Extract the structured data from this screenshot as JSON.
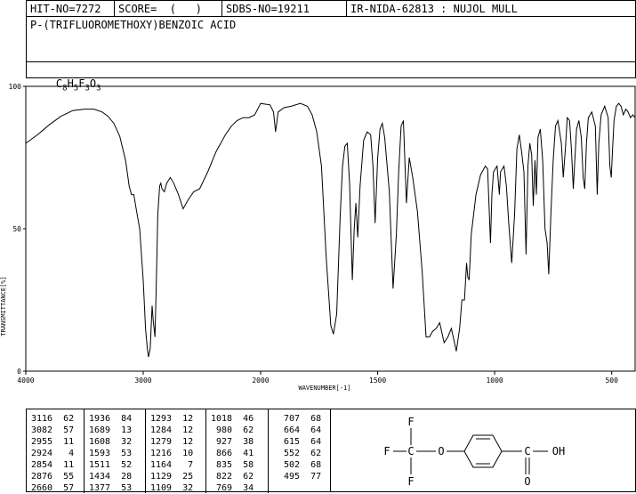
{
  "header": {
    "hit_no": "HIT-NO=7272",
    "score": "SCORE=  (   )",
    "sdbs_no": "SDBS-NO=19211",
    "ir_info": "IR-NIDA-62813 : NUJOL MULL",
    "compound_name": "P-(TRIFLUOROMETHOXY)BENZOIC ACID",
    "formula_main": "C",
    "formula": [
      {
        "el": "C",
        "n": "8"
      },
      {
        "el": "H",
        "n": "5"
      },
      {
        "el": "F",
        "n": "3"
      },
      {
        "el": "O",
        "n": "3"
      }
    ]
  },
  "chart_data": {
    "type": "line",
    "xlabel": "WAVENUMBER[-1]",
    "ylabel": "TRANSMITTANCE[%]",
    "xlim": [
      4000,
      400
    ],
    "ylim": [
      0,
      100
    ],
    "x_ticks": [
      "4000",
      "3000",
      "2000",
      "1500",
      "1000",
      "500"
    ],
    "x_tick_values": [
      4000,
      3000,
      2000,
      1500,
      1000,
      500
    ],
    "y_ticks": [
      "0",
      "50",
      "100"
    ],
    "y_tick_values": [
      0,
      50,
      100
    ],
    "line_color": "#000000",
    "series": [
      {
        "points": [
          [
            4000,
            80
          ],
          [
            3900,
            83
          ],
          [
            3800,
            86.5
          ],
          [
            3700,
            89.5
          ],
          [
            3600,
            91.5
          ],
          [
            3500,
            92
          ],
          [
            3420,
            92
          ],
          [
            3350,
            91
          ],
          [
            3300,
            89.5
          ],
          [
            3250,
            87
          ],
          [
            3200,
            82.5
          ],
          [
            3150,
            74
          ],
          [
            3120,
            65
          ],
          [
            3100,
            62
          ],
          [
            3080,
            62
          ],
          [
            3060,
            57
          ],
          [
            3030,
            50
          ],
          [
            3000,
            32
          ],
          [
            2980,
            15
          ],
          [
            2965,
            8
          ],
          [
            2955,
            5
          ],
          [
            2940,
            8
          ],
          [
            2924,
            23
          ],
          [
            2915,
            18
          ],
          [
            2900,
            12
          ],
          [
            2890,
            28
          ],
          [
            2876,
            55
          ],
          [
            2860,
            65
          ],
          [
            2850,
            66
          ],
          [
            2840,
            64
          ],
          [
            2820,
            63
          ],
          [
            2800,
            66
          ],
          [
            2770,
            68
          ],
          [
            2740,
            66
          ],
          [
            2700,
            62
          ],
          [
            2660,
            57
          ],
          [
            2620,
            60
          ],
          [
            2570,
            63
          ],
          [
            2520,
            64
          ],
          [
            2450,
            70
          ],
          [
            2380,
            77
          ],
          [
            2300,
            83
          ],
          [
            2250,
            86
          ],
          [
            2200,
            88
          ],
          [
            2150,
            89
          ],
          [
            2100,
            89
          ],
          [
            2050,
            90
          ],
          [
            2000,
            94
          ],
          [
            1960,
            93.5
          ],
          [
            1945,
            91
          ],
          [
            1936,
            84
          ],
          [
            1925,
            91
          ],
          [
            1900,
            92.5
          ],
          [
            1870,
            93
          ],
          [
            1830,
            94
          ],
          [
            1800,
            93
          ],
          [
            1780,
            90
          ],
          [
            1760,
            84
          ],
          [
            1740,
            72
          ],
          [
            1720,
            40
          ],
          [
            1700,
            16
          ],
          [
            1689,
            13
          ],
          [
            1675,
            20
          ],
          [
            1660,
            55
          ],
          [
            1650,
            72
          ],
          [
            1640,
            79
          ],
          [
            1630,
            80
          ],
          [
            1620,
            66
          ],
          [
            1608,
            32
          ],
          [
            1600,
            50
          ],
          [
            1593,
            59
          ],
          [
            1585,
            47
          ],
          [
            1575,
            65
          ],
          [
            1560,
            81
          ],
          [
            1545,
            84
          ],
          [
            1530,
            83
          ],
          [
            1520,
            72
          ],
          [
            1511,
            52
          ],
          [
            1500,
            75
          ],
          [
            1490,
            85
          ],
          [
            1480,
            87
          ],
          [
            1470,
            82
          ],
          [
            1450,
            63
          ],
          [
            1434,
            29
          ],
          [
            1420,
            48
          ],
          [
            1410,
            70
          ],
          [
            1400,
            86
          ],
          [
            1390,
            88
          ],
          [
            1377,
            59
          ],
          [
            1365,
            75
          ],
          [
            1350,
            68
          ],
          [
            1330,
            56
          ],
          [
            1310,
            35
          ],
          [
            1293,
            12
          ],
          [
            1284,
            12
          ],
          [
            1279,
            12
          ],
          [
            1265,
            14
          ],
          [
            1250,
            15
          ],
          [
            1235,
            17
          ],
          [
            1216,
            10
          ],
          [
            1200,
            12
          ],
          [
            1185,
            15
          ],
          [
            1164,
            7
          ],
          [
            1150,
            15
          ],
          [
            1140,
            25
          ],
          [
            1129,
            25
          ],
          [
            1120,
            38
          ],
          [
            1115,
            33
          ],
          [
            1109,
            32
          ],
          [
            1100,
            48
          ],
          [
            1080,
            62
          ],
          [
            1060,
            69
          ],
          [
            1040,
            72
          ],
          [
            1030,
            71
          ],
          [
            1018,
            45
          ],
          [
            1012,
            62
          ],
          [
            1005,
            70
          ],
          [
            990,
            72
          ],
          [
            980,
            62
          ],
          [
            975,
            70
          ],
          [
            960,
            72
          ],
          [
            950,
            65
          ],
          [
            940,
            52
          ],
          [
            927,
            38
          ],
          [
            915,
            55
          ],
          [
            905,
            78
          ],
          [
            895,
            83
          ],
          [
            885,
            77
          ],
          [
            875,
            70
          ],
          [
            866,
            41
          ],
          [
            858,
            72
          ],
          [
            850,
            80
          ],
          [
            842,
            76
          ],
          [
            835,
            58
          ],
          [
            828,
            74
          ],
          [
            822,
            62
          ],
          [
            815,
            82
          ],
          [
            805,
            85
          ],
          [
            795,
            74
          ],
          [
            785,
            50
          ],
          [
            776,
            45
          ],
          [
            769,
            34
          ],
          [
            760,
            55
          ],
          [
            750,
            74
          ],
          [
            740,
            86
          ],
          [
            730,
            88
          ],
          [
            715,
            80
          ],
          [
            707,
            68
          ],
          [
            698,
            78
          ],
          [
            690,
            89
          ],
          [
            680,
            88
          ],
          [
            672,
            78
          ],
          [
            664,
            64
          ],
          [
            655,
            78
          ],
          [
            650,
            85
          ],
          [
            640,
            88
          ],
          [
            630,
            82
          ],
          [
            622,
            68
          ],
          [
            615,
            64
          ],
          [
            608,
            80
          ],
          [
            600,
            89
          ],
          [
            585,
            91
          ],
          [
            570,
            86
          ],
          [
            562,
            62
          ],
          [
            555,
            80
          ],
          [
            545,
            90
          ],
          [
            530,
            93
          ],
          [
            515,
            89
          ],
          [
            508,
            72
          ],
          [
            502,
            68
          ],
          [
            497,
            77
          ],
          [
            490,
            88
          ],
          [
            480,
            93
          ],
          [
            470,
            94
          ],
          [
            460,
            93
          ],
          [
            450,
            90
          ],
          [
            440,
            92
          ],
          [
            430,
            91
          ],
          [
            420,
            89
          ],
          [
            410,
            90
          ],
          [
            400,
            89
          ]
        ]
      }
    ]
  },
  "peak_table": [
    [
      "3116  62",
      "3082  57",
      "2955  11",
      "2924   4",
      "2854  11",
      "2876  55",
      "2660  57"
    ],
    [
      "1936  84",
      "1689  13",
      "1608  32",
      "1593  53",
      "1511  52",
      "1434  28",
      "1377  53"
    ],
    [
      "1293  12",
      "1284  12",
      "1279  12",
      "1216  10",
      "1164   7",
      "1129  25",
      "1109  32"
    ],
    [
      "1018  46",
      " 980  62",
      " 927  38",
      " 866  41",
      " 835  58",
      " 822  62",
      " 769  34"
    ],
    [
      " 707  68",
      " 664  64",
      " 615  64",
      " 552  62",
      " 502  68",
      " 495  77",
      ""
    ]
  ],
  "structure": {
    "f_top": "F",
    "f_left": "F",
    "f_bottom": "F",
    "c_cf3": "C",
    "o_ether": "O",
    "c_acid": "C",
    "oh": "OH",
    "o_carbonyl": "O"
  }
}
